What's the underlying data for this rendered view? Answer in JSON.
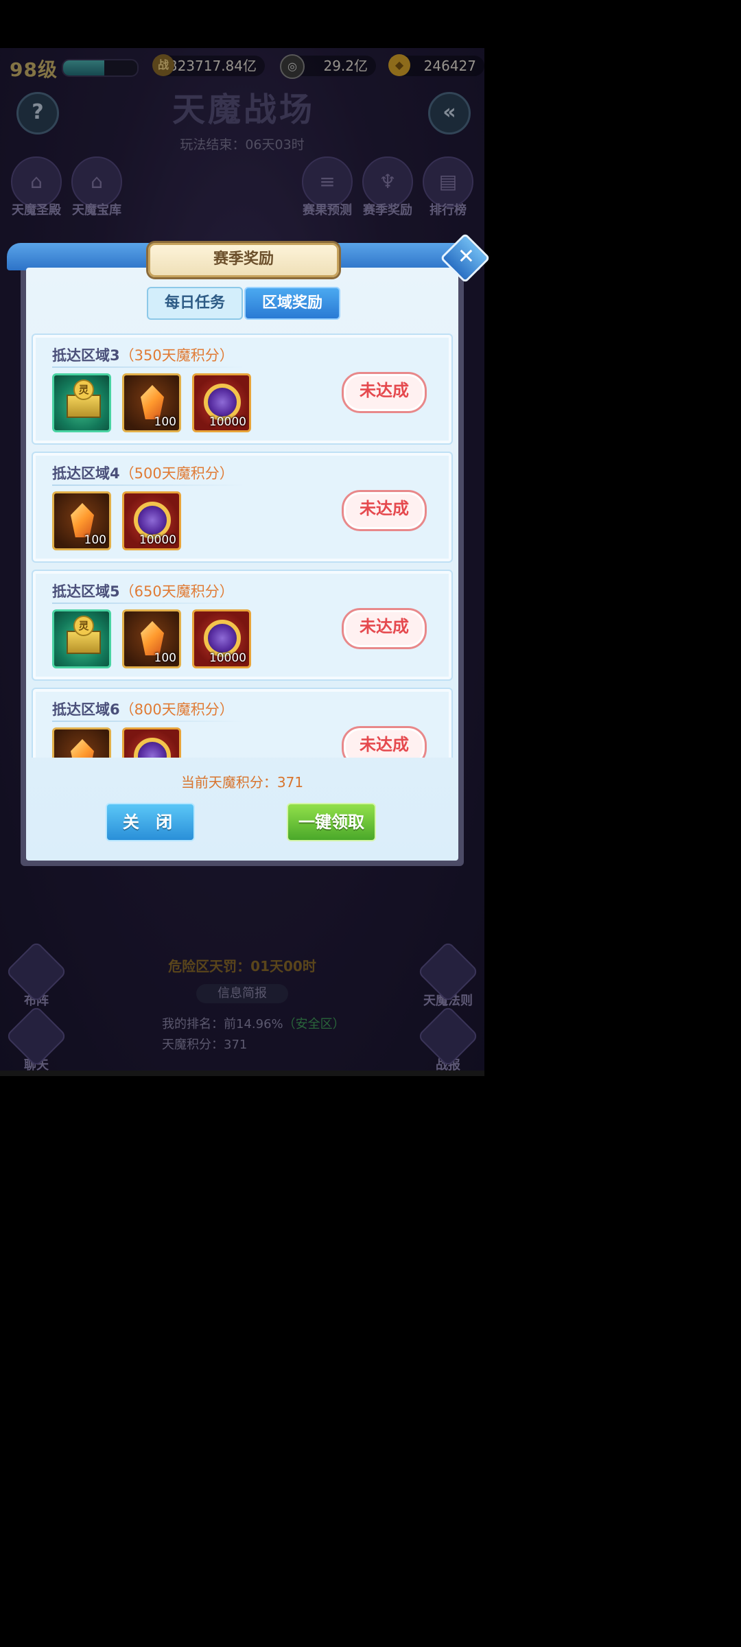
{
  "topbar": {
    "level": "98级",
    "exp_fraction": 0.56,
    "battle_power": "323717.84亿",
    "battle_power_icon": "战",
    "coins": "29.2亿",
    "gold": "246427"
  },
  "header": {
    "title": "天魔战场",
    "end_time": "玩法结束：06天03时"
  },
  "side_buttons_left": [
    {
      "label": "天魔圣殿",
      "icon": "palace-icon"
    },
    {
      "label": "天魔宝库",
      "icon": "treasury-icon"
    }
  ],
  "side_buttons_right": [
    {
      "label": "赛果预测",
      "icon": "scroll-icon"
    },
    {
      "label": "赛季奖励",
      "icon": "trophy-icon"
    },
    {
      "label": "排行榜",
      "icon": "ranking-icon"
    }
  ],
  "modal": {
    "title": "赛季奖励",
    "tabs": [
      "每日任务",
      "区域奖励"
    ],
    "active_tab": "区域奖励",
    "rewards": [
      {
        "zone": "抵达区域3",
        "points": "（350天魔积分）",
        "status": "未达成",
        "items": [
          {
            "type": "chest",
            "seal": "灵",
            "qty": ""
          },
          {
            "type": "crystal",
            "qty": "100"
          },
          {
            "type": "orb",
            "qty": "10000"
          }
        ]
      },
      {
        "zone": "抵达区域4",
        "points": "（500天魔积分）",
        "status": "未达成",
        "items": [
          {
            "type": "crystal",
            "qty": "100"
          },
          {
            "type": "orb",
            "qty": "10000"
          }
        ]
      },
      {
        "zone": "抵达区域5",
        "points": "（650天魔积分）",
        "status": "未达成",
        "items": [
          {
            "type": "chest",
            "seal": "灵",
            "qty": ""
          },
          {
            "type": "crystal",
            "qty": "100"
          },
          {
            "type": "orb",
            "qty": "10000"
          }
        ]
      },
      {
        "zone": "抵达区域6",
        "points": "（800天魔积分）",
        "status": "未达成",
        "items": [
          {
            "type": "crystal",
            "qty": ""
          },
          {
            "type": "orb",
            "qty": ""
          }
        ]
      }
    ],
    "current_score": "当前天魔积分：371",
    "close_label": "关 闭",
    "claim_label": "一键领取"
  },
  "bottom": {
    "penalty": "危险区天罚：01天00时",
    "info_title": "信息简报",
    "rank_prefix": "我的排名：前14.96%",
    "rank_zone": "（安全区）",
    "score": "天魔积分：371",
    "left_buttons": [
      "布阵",
      "聊天"
    ],
    "right_buttons": [
      "天魔法则",
      "战报"
    ]
  }
}
